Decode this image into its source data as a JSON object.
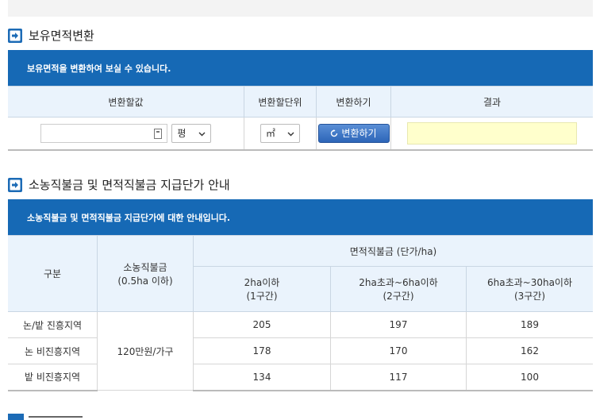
{
  "section1": {
    "title": "보유면적변환",
    "bar": "보유면적을 변환하여 보실 수 있습니다.",
    "headers": [
      "변환할값",
      "변환할단위",
      "변환하기",
      "결과"
    ],
    "input_value": "",
    "unit_select": "평",
    "target_unit_select": "㎡",
    "convert_button": "변환하기",
    "result_value": ""
  },
  "section2": {
    "title": "소농직불금 및 면적직불금 지급단가 안내",
    "bar": "소농직불금 및 면적직불금 지급단가에 대한 안내입니다.",
    "col_category": "구분",
    "col_small": [
      "소농직불금",
      "(0.5ha 이하)"
    ],
    "col_area": "면적직불금 (단가/ha)",
    "sub_cols": [
      [
        "2ha이하",
        "(1구간)"
      ],
      [
        "2ha초과~6ha이하",
        "(2구간)"
      ],
      [
        "6ha초과~30ha이하",
        "(3구간)"
      ]
    ],
    "small_value": "120만원/가구",
    "rows": [
      {
        "label": "논/밭 진흥지역",
        "v1": "205",
        "v2": "197",
        "v3": "189"
      },
      {
        "label": "논 비진흥지역",
        "v1": "178",
        "v2": "170",
        "v3": "162"
      },
      {
        "label": "밭 비진흥지역",
        "v1": "134",
        "v2": "117",
        "v3": "100"
      }
    ]
  }
}
